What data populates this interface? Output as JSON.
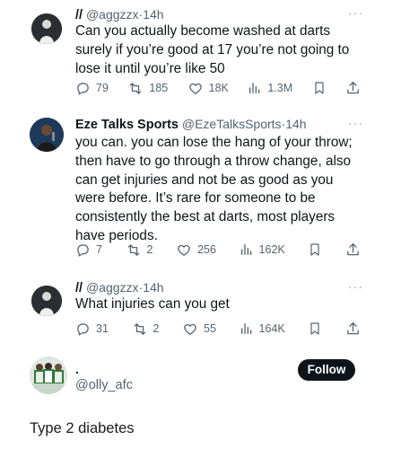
{
  "tweets": [
    {
      "name": "//",
      "handle": "@aggzzx",
      "time": "14h",
      "text": "Can you actually become washed at darts surely if you’re good at 17 you’re not going to lose it until you’re like 50",
      "replies": "79",
      "reposts": "185",
      "likes": "18K",
      "views": "1.3M"
    },
    {
      "name": "Eze Talks Sports",
      "handle": "@EzeTalksSports",
      "time": "14h",
      "text": "you can. you can lose the hang of your throw; then have to go through a throw change, also can get injuries and not be as good as you were before. It’s rare for someone to be consistently the best at darts, most players have periods.",
      "replies": "7",
      "reposts": "2",
      "likes": "256",
      "views": "162K"
    },
    {
      "name": "//",
      "handle": "@aggzzx",
      "time": "14h",
      "text": "What injuries can you get",
      "replies": "31",
      "reposts": "2",
      "likes": "55",
      "views": "164K"
    }
  ],
  "reply": {
    "name": ".",
    "handle": "@olly_afc",
    "follow_label": "Follow"
  },
  "caption": "Type 2 diabetes",
  "separator": "·",
  "more_label": "···",
  "colors": {
    "text": "#0f1419",
    "muted": "#536471",
    "follow_bg": "#0f1419"
  },
  "icons": [
    "reply-icon",
    "repost-icon",
    "like-icon",
    "views-icon",
    "bookmark-icon",
    "share-icon"
  ]
}
